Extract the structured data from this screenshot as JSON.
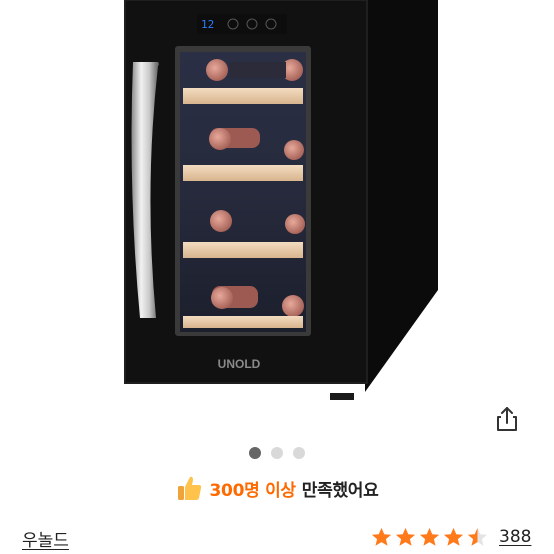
{
  "product": {
    "image_alt": "wine cooler product photo",
    "display_temperature": "12",
    "brand_logo_text": "UNOLD"
  },
  "carousel": {
    "total": 3,
    "active_index": 0
  },
  "satisfaction": {
    "icon": "thumbs-up-icon",
    "highlight": "300명 이상",
    "rest": "만족했어요",
    "highlight_color": "#ff6a00"
  },
  "brand": {
    "name": "우놀드"
  },
  "rating": {
    "stars": 4.5,
    "max_stars": 5,
    "star_color": "#ff7a1a",
    "review_count": "388"
  },
  "share": {
    "icon": "share-icon"
  }
}
